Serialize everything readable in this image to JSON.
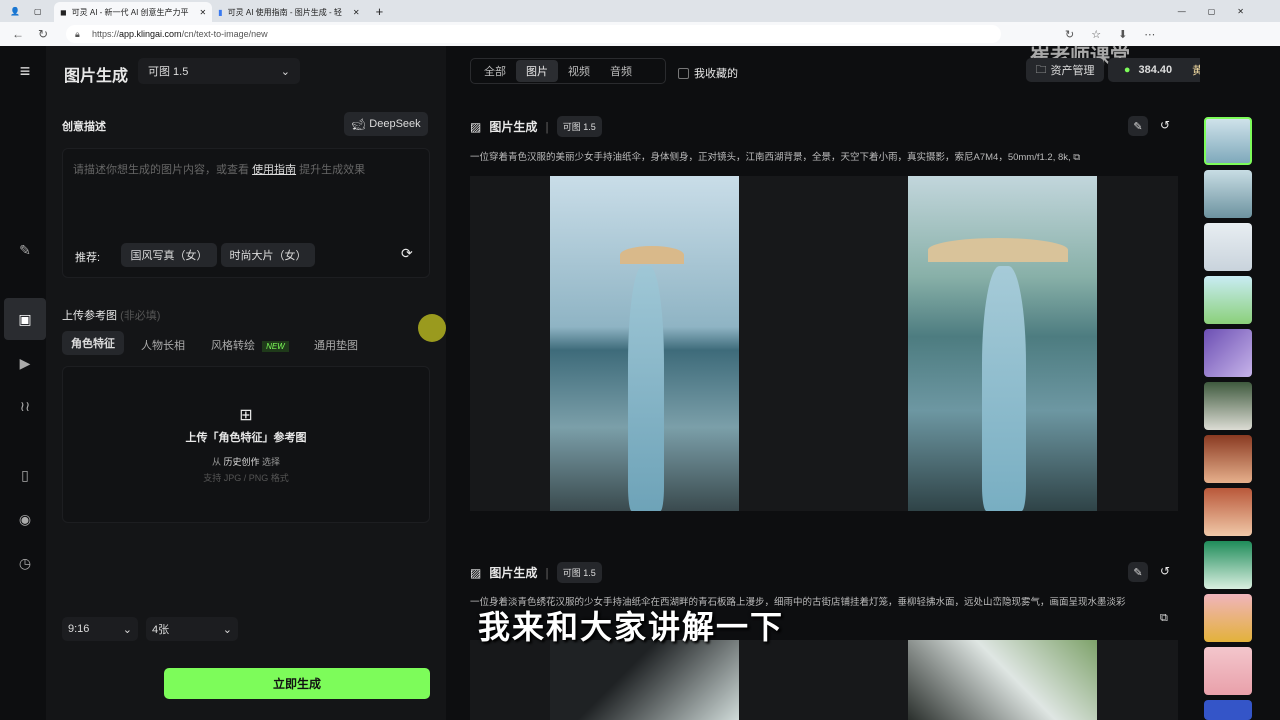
{
  "browser": {
    "tabs": [
      {
        "title": "可灵 AI - 新一代 AI 创意生产力平"
      },
      {
        "title": "可灵 AI 使用指南 - 图片生成 - 轻"
      }
    ],
    "url_prefix": "https://",
    "url_domain": "app.klingai.com",
    "url_path": "/cn/text-to-image/new"
  },
  "header": {
    "title": "图片生成",
    "model": "可图 1.5",
    "filters": [
      "全部",
      "图片",
      "视频",
      "音频"
    ],
    "favorites": "我收藏的",
    "assets": "资产管理",
    "credits": "384.40",
    "membership": "黄金会员",
    "watermark": "崔老师课堂"
  },
  "prompt": {
    "section": "创意描述",
    "deepseek": "DeepSeek",
    "placeholder_a": "请描述你想生成的图片内容，或查看",
    "guide_link": "使用指南",
    "placeholder_b": "提升生成效果",
    "recommend_label": "推荐:",
    "recommend": [
      "国风写真（女）",
      "时尚大片（女）"
    ]
  },
  "reference": {
    "title": "上传参考图",
    "optional": "(非必填)",
    "tabs": [
      "角色特征",
      "人物长相",
      "风格转绘",
      "通用垫图"
    ],
    "new_badge": "NEW",
    "upload_title": "上传「角色特征」参考图",
    "from": "从",
    "history": "历史创作",
    "select": "选择",
    "formats": "支持 JPG / PNG 格式"
  },
  "settings": {
    "ratio": "9:16",
    "count": "4张",
    "generate": "立即生成"
  },
  "results": [
    {
      "title": "图片生成",
      "model": "可图 1.5",
      "prompt": "一位穿着青色汉服的美丽少女手持油纸伞，身体侧身，正对镜头，江南西湖背景，全景，天空下着小雨，真实摄影，索尼A7M4，50mm/f1.2, 8k,"
    },
    {
      "title": "图片生成",
      "model": "可图 1.5",
      "prompt": "一位身着淡青色绣花汉服的少女手持油纸伞在西湖畔的青石板路上漫步，细雨中的古街店铺挂着灯笼，垂柳轻拂水面，远处山峦隐现雾气，画面呈现水墨淡彩"
    }
  ],
  "subtitle": "我来和大家讲解一下",
  "colors": {
    "accent": "#7dfc5a",
    "bg": "#0d0e10",
    "panel": "#141517"
  }
}
